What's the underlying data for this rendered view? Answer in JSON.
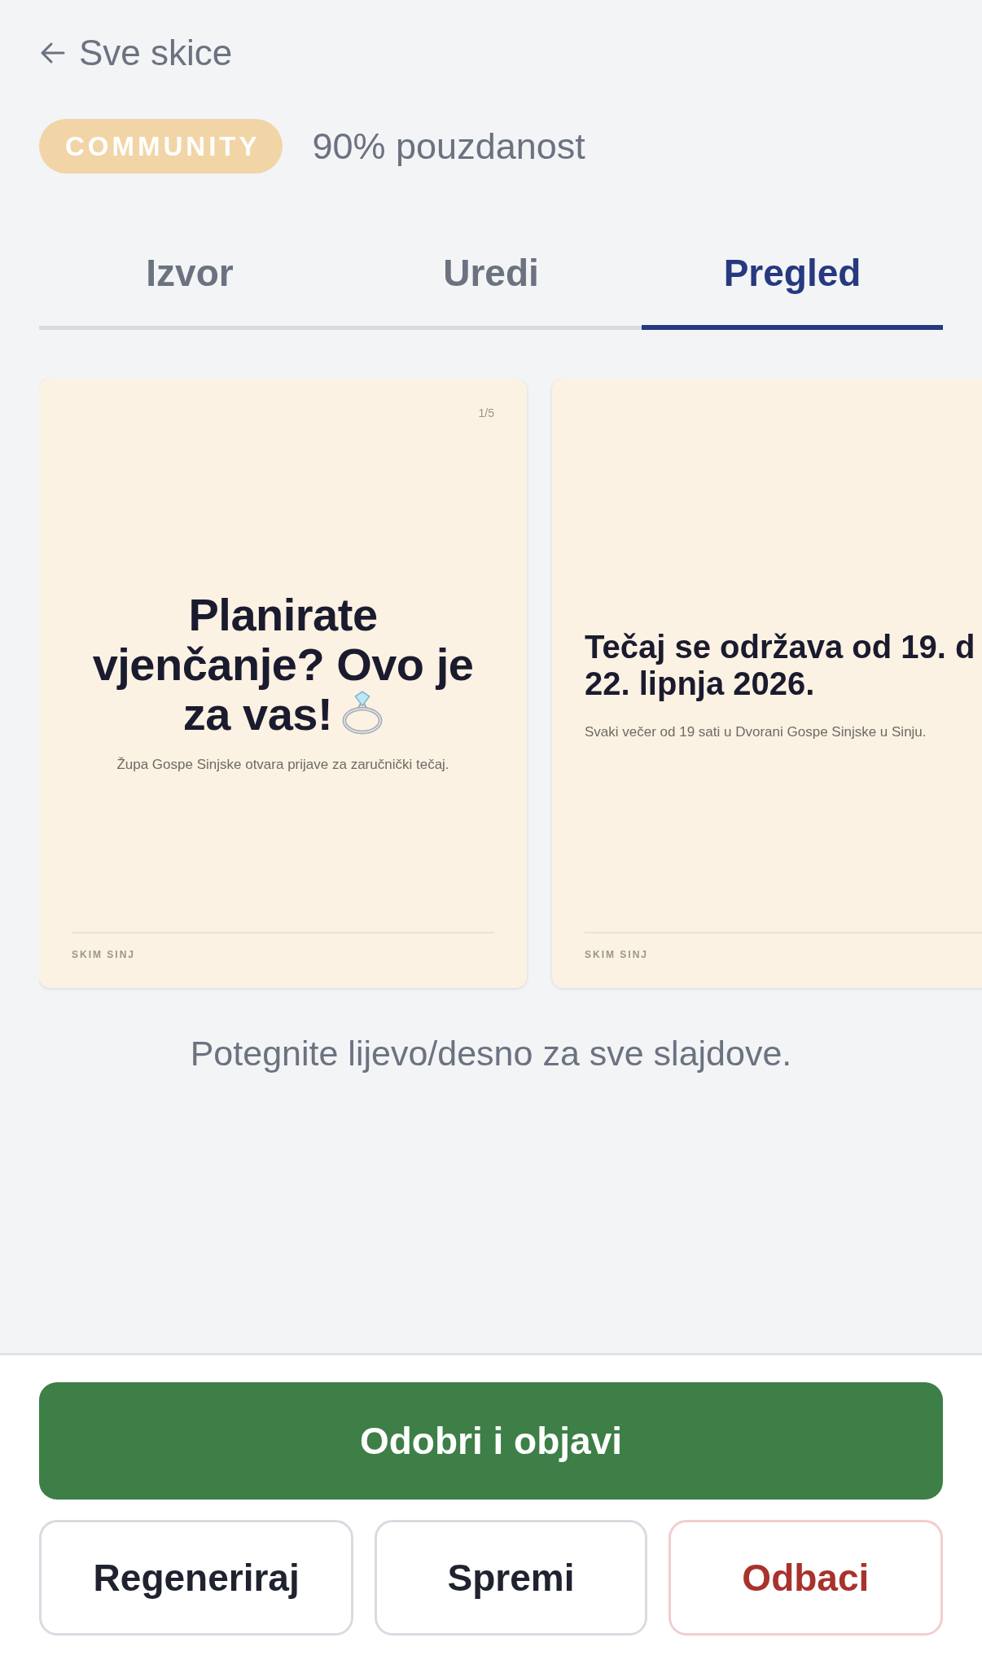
{
  "back_link": {
    "label": "Sve skice"
  },
  "badge": {
    "label": "COMMUNITY"
  },
  "confidence": "90% pouzdanost",
  "tabs": [
    {
      "label": "Izvor",
      "selected": false
    },
    {
      "label": "Uredi",
      "selected": false
    },
    {
      "label": "Pregled",
      "selected": true
    }
  ],
  "slides": [
    {
      "kind": "cover",
      "counter": "1/5",
      "title_lines": [
        "Planirate",
        "vjenčanje? Ovo je",
        "za vas!"
      ],
      "title_icon": true,
      "subtitle": "Župa Gospe Sinjske otvara prijave za zaručnički tečaj.",
      "footer": "SKIM SINJ"
    },
    {
      "kind": "content",
      "title": "Tečaj se održava od 19. d\n22. lipnja 2026.",
      "subtitle": "Svaki večer od 19 sati u Dvorani Gospe Sinjske u Sinju.",
      "footer": "SKIM SINJ"
    }
  ],
  "hint": "Potegnite lijevo/desno za sve slajdove.",
  "primary_action": "Odobri i objavi",
  "actions": [
    {
      "label": "Regeneriraj",
      "kind": "neutral"
    },
    {
      "label": "Spremi",
      "kind": "neutral"
    },
    {
      "label": "Odbaci",
      "kind": "danger"
    }
  ]
}
